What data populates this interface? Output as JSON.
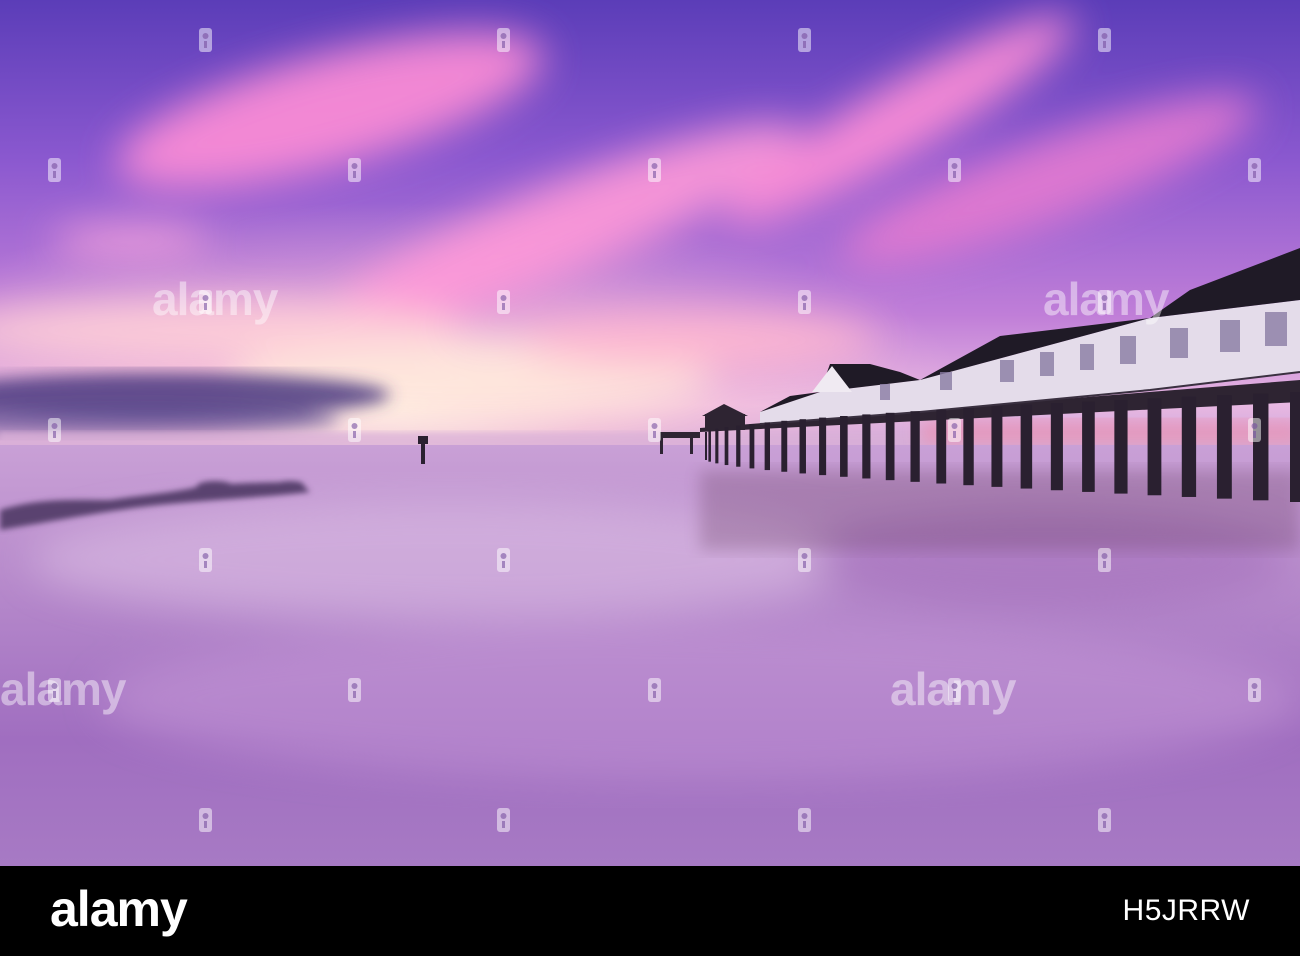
{
  "watermark": {
    "brand": "alamy"
  },
  "footer": {
    "brand": "alamy",
    "image_id": "H5JRRW"
  },
  "colors": {
    "sky_top": "#5a3fb5",
    "sky_mid": "#b46ad8",
    "horizon_glow": "#fde0e8",
    "sea": "#b887c9",
    "sea_shore": "#8f5fb0",
    "pier_dark": "#2d2330",
    "footer": "#000000"
  }
}
